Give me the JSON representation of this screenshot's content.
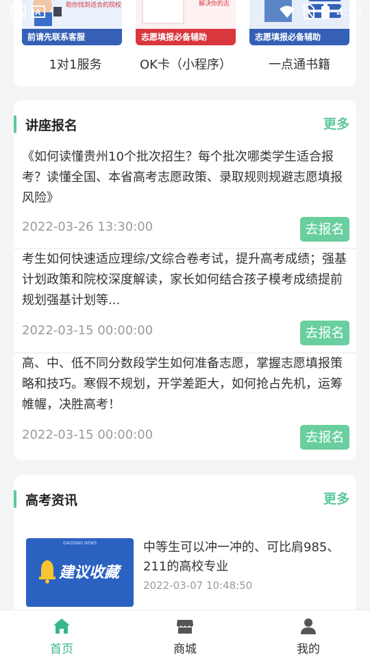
{
  "status_bar": {
    "time": "4:13",
    "icons": [
      "gallery-icon",
      "a-icon",
      "wifi-icon",
      "no-sim-icon",
      "battery-icon"
    ]
  },
  "services": {
    "items": [
      {
        "label": "1对1服务",
        "banner": "前请先联系客服",
        "top_text": "助你找到适合的院校",
        "icon": "service-image"
      },
      {
        "label": "OK卡（小程序）",
        "banner": "志愿填报必备辅助",
        "top_text": "解决你的志",
        "icon": "okcard-image"
      },
      {
        "label": "一点通书籍",
        "banner": "志愿填报必备辅助",
        "icon": "book-image"
      }
    ]
  },
  "lectures": {
    "title": "讲座报名",
    "more": "更多",
    "items": [
      {
        "desc": "《如何读懂贵州10个批次招生？每个批次哪类学生适合报考？读懂全国、本省高考志愿政策、录取规则规避志愿填报风险》",
        "date": "2022-03-26 13:30:00",
        "button": "去报名"
      },
      {
        "desc": "考生如何快速适应理综/文综合卷考试，提升高考成绩；强基计划政策和院校深度解读，家长如何结合孩子模考成绩提前规划强基计划等...",
        "date": "2022-03-15 00:00:00",
        "button": "去报名"
      },
      {
        "desc": "高、中、低不同分数段学生如何准备志愿，掌握志愿填报策略和技巧。寒假不规划，开学差距大，如何抢占先机，运筹帷幄，决胜高考！",
        "date": "2022-03-15 00:00:00",
        "button": "去报名"
      }
    ]
  },
  "news": {
    "title": "高考资讯",
    "more": "更多",
    "items": [
      {
        "thumb_small": "GAODING NEWS",
        "thumb_text": "建议收藏",
        "title": "中等生可以冲一冲的、可比肩985、211的高校专业",
        "date": "2022-03-07 10:48:50"
      }
    ]
  },
  "tabbar": {
    "items": [
      {
        "label": "首页",
        "icon": "home-icon",
        "active": true
      },
      {
        "label": "商城",
        "icon": "store-icon",
        "active": false
      },
      {
        "label": "我的",
        "icon": "profile-icon",
        "active": false
      }
    ]
  },
  "colors": {
    "accent": "#5cc89a",
    "button": "#69cf9f",
    "tab_active": "#3ab68a",
    "banner_red": "#d9363e",
    "banner_blue": "#3560b6"
  }
}
